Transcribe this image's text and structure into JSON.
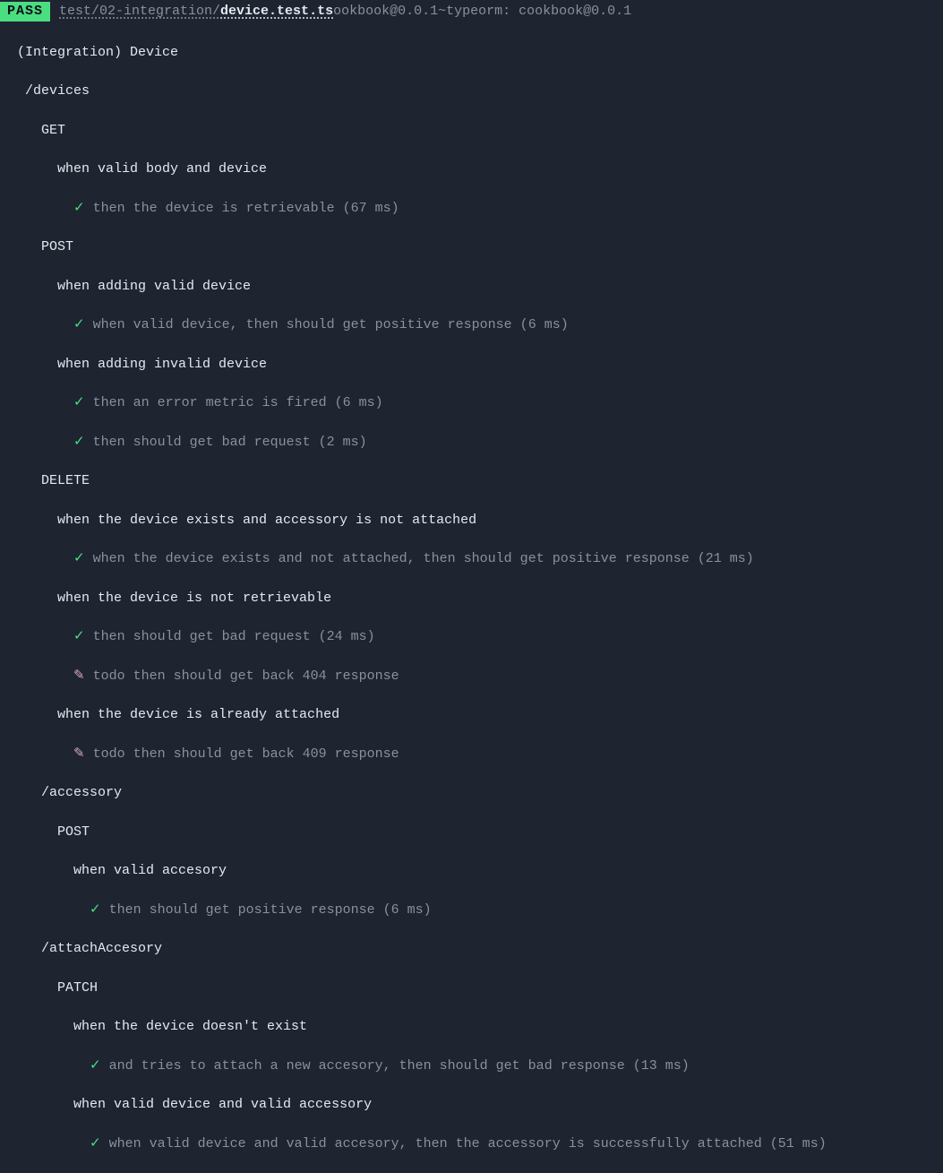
{
  "header": {
    "badge": "PASS",
    "path_prefix": "test/02-integration/",
    "file_name": "device.test.ts",
    "extra": "ookbook@0.0.1~typeorm: cookbook@0.0.1"
  },
  "suite": "(Integration) Device",
  "routes": {
    "devices": {
      "name": "/devices",
      "get": {
        "label": "GET",
        "when_valid": "when valid body and device",
        "test_retrievable": "then the device is retrievable (67 ms)"
      },
      "post": {
        "label": "POST",
        "when_adding_valid": "when adding valid device",
        "test_positive": "when valid device, then should get positive response (6 ms)",
        "when_adding_invalid": "when adding invalid device",
        "test_error_metric": "then an error metric is fired (6 ms)",
        "test_bad_request": "then should get bad request (2 ms)"
      },
      "delete": {
        "label": "DELETE",
        "when_exists_not_attached": "when the device exists and accessory is not attached",
        "test_positive": "when the device exists and not attached, then should get positive response (21 ms)",
        "when_not_retrievable": "when the device is not retrievable",
        "test_bad_request": "then should get bad request (24 ms)",
        "todo_404": "todo then should get back 404 response",
        "when_already_attached": "when the device is already attached",
        "todo_409": "todo then should get back 409 response"
      }
    },
    "accessory": {
      "name": "/accessory",
      "post": {
        "label": "POST",
        "when_valid": "when valid accesory",
        "test_positive": "then should get positive response (6 ms)"
      }
    },
    "attach": {
      "name": "/attachAccesory",
      "patch": {
        "label": "PATCH",
        "when_no_device": "when the device doesn't exist",
        "test_bad_response": "and tries to attach a new accesory, then should get bad response (13 ms)",
        "when_valid_both": "when valid device and valid accessory",
        "test_success": "when valid device and valid accesory, then the accessory is successfully attached (51 ms)"
      }
    }
  },
  "icons": {
    "check": "✓",
    "todo": "✎"
  }
}
